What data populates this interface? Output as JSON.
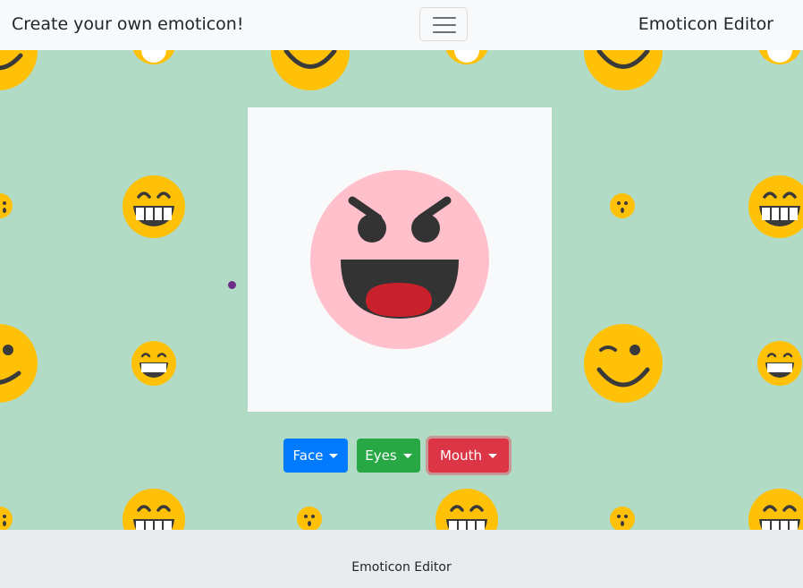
{
  "navbar": {
    "brand": "Create your own emoticon!",
    "right_link": "Emoticon Editor",
    "toggler_icon": "hamburger-menu-icon"
  },
  "background": {
    "color": "#b1dbc4",
    "emoji_color": "#ffc107",
    "pattern_icons": [
      "smile-emoji-icon",
      "wink-emoji-icon",
      "grin-emoji-icon",
      "surprised-emoji-icon"
    ]
  },
  "editor": {
    "face": {
      "name": "round-face",
      "color": "#ffc0cb"
    },
    "eyes": {
      "name": "angry-eyes-icon",
      "color": "#333333"
    },
    "mouth": {
      "name": "open-mouth-tongue-icon",
      "color": "#333333",
      "tongue_color": "#c8212b"
    }
  },
  "controls": {
    "face_label": "Face",
    "eyes_label": "Eyes",
    "mouth_label": "Mouth",
    "colors": {
      "face": "#007bff",
      "eyes": "#28a745",
      "mouth": "#dc3545"
    }
  },
  "footer": {
    "text": "Emoticon Editor"
  }
}
